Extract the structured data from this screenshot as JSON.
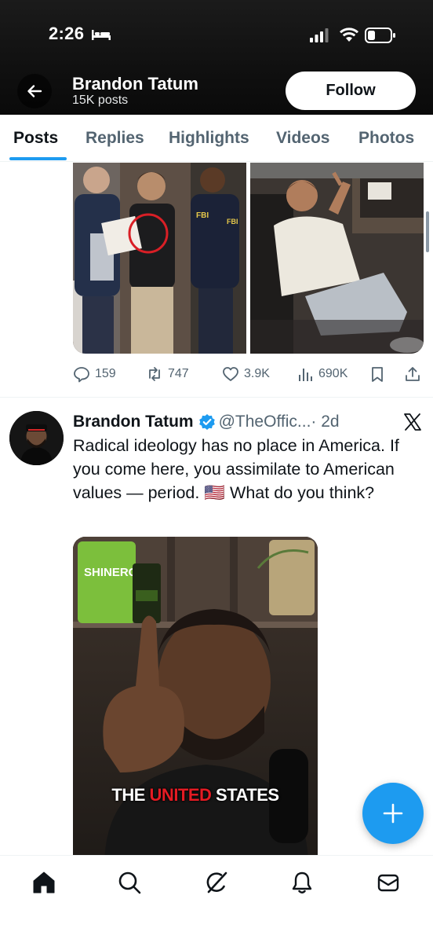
{
  "status_bar": {
    "time": "2:26"
  },
  "header": {
    "name": "Brandon Tatum",
    "posts": "15K posts",
    "follow_label": "Follow"
  },
  "tabs": [
    {
      "label": "Posts",
      "active": true
    },
    {
      "label": "Replies"
    },
    {
      "label": "Highlights"
    },
    {
      "label": "Videos"
    },
    {
      "label": "Photos"
    }
  ],
  "post1": {
    "replies": "159",
    "reposts": "747",
    "likes": "3.9K",
    "views": "690K"
  },
  "post2": {
    "author": "Brandon Tatum",
    "handle": "@TheOffic...",
    "time": "· 2d",
    "text": "Radical ideology has no place in America. If you come here, you assimilate to American values — period. 🇺🇸 What do you think?",
    "caption_pre": "THE ",
    "caption_hl": "UNITED",
    "caption_post": " STATES",
    "brand_text": "SHINERGY"
  },
  "colors": {
    "accent": "#1d9bf0",
    "text_primary": "#0f1419",
    "text_secondary": "#536471"
  }
}
